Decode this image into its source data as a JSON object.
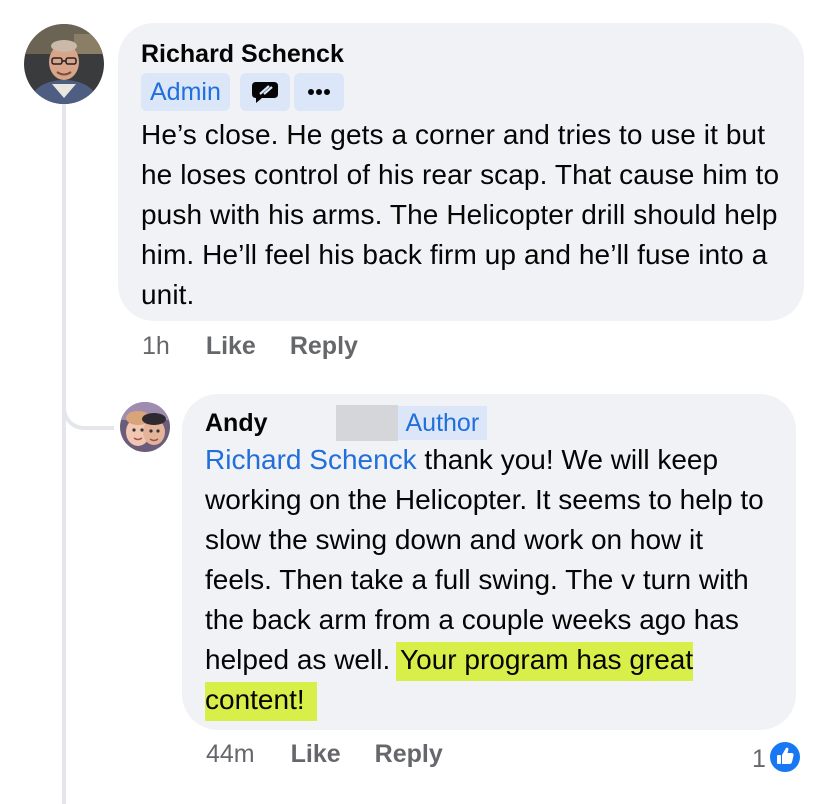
{
  "comment": {
    "author": "Richard Schenck",
    "badge": "Admin",
    "text": "He’s close. He gets a corner and tries to use it but he loses control of his rear scap. That cause him to push with his arms. The Helicopter drill should help him. He’ll feel his back firm up and he’ll fuse into a unit.",
    "time": "1h",
    "like_label": "Like",
    "reply_label": "Reply",
    "icons": [
      "message-icon",
      "more-icon"
    ]
  },
  "reply": {
    "author": "Andy",
    "badge": "Author",
    "mention": "Richard Schenck",
    "text": " thank you! We will keep working on the Helicopter. It seems to help to slow the swing down and work on how it feels. Then take a full swing. The v turn with the back arm from a couple weeks ago has helped as well. ",
    "highlighted_text": "Your program has great content!",
    "time": "44m",
    "like_label": "Like",
    "reply_label": "Reply",
    "reaction_count": "1",
    "reaction_icon": "like-thumb-icon"
  },
  "colors": {
    "bubble": "#f0f2f5",
    "accent": "#216fdb",
    "badge_bg": "#dbe7f9",
    "highlight": "#d8ef4a",
    "meta": "#65676b"
  }
}
